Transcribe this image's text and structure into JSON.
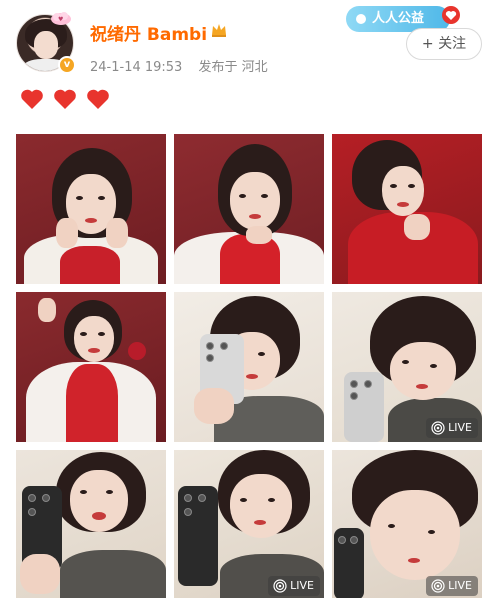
{
  "user": {
    "name": "祝绪丹 Bambi",
    "timestamp": "24-1-14 19:53",
    "location": "发布于 河北",
    "verified_color": "#f5a623"
  },
  "charity": {
    "label": "人人公益"
  },
  "follow_button": {
    "label": "+ 关注"
  },
  "reactions": {
    "hearts": 3,
    "heart_color": "#e8342d"
  },
  "photos": [
    {
      "live": false,
      "live_label": ""
    },
    {
      "live": false,
      "live_label": ""
    },
    {
      "live": false,
      "live_label": ""
    },
    {
      "live": false,
      "live_label": ""
    },
    {
      "live": false,
      "live_label": ""
    },
    {
      "live": true,
      "live_label": "LIVE"
    },
    {
      "live": false,
      "live_label": ""
    },
    {
      "live": true,
      "live_label": "LIVE"
    },
    {
      "live": true,
      "live_label": "LIVE"
    }
  ]
}
